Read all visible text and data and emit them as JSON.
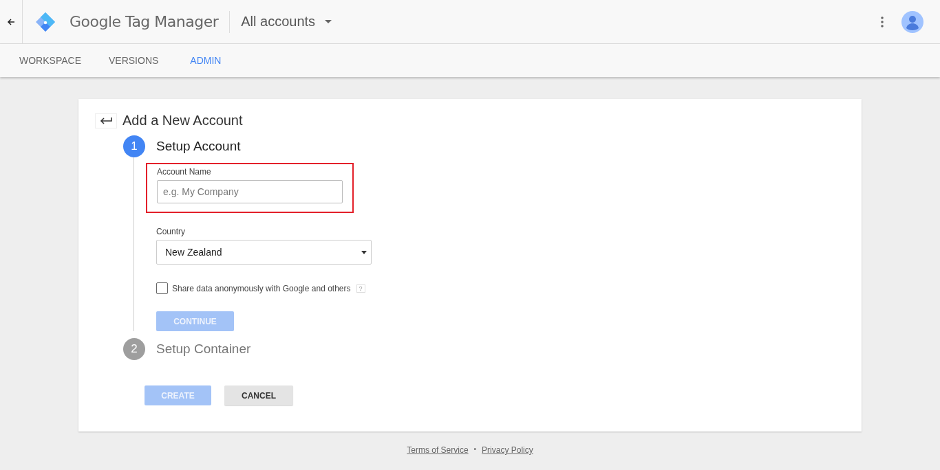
{
  "header": {
    "brand": "Google",
    "product_suffix": "Tag Manager",
    "account_switcher": "All accounts"
  },
  "tabs": [
    {
      "label": "WORKSPACE",
      "selected": false
    },
    {
      "label": "VERSIONS",
      "selected": false
    },
    {
      "label": "ADMIN",
      "selected": true
    }
  ],
  "card": {
    "title": "Add a New Account",
    "steps": [
      {
        "number": "1",
        "title": "Setup Account",
        "active": true
      },
      {
        "number": "2",
        "title": "Setup Container",
        "active": false
      }
    ],
    "account_name": {
      "label": "Account Name",
      "placeholder": "e.g. My Company",
      "highlighted": true
    },
    "country": {
      "label": "Country",
      "value": "New Zealand"
    },
    "share_data": {
      "label": "Share data anonymously with Google and others",
      "checked": false,
      "help": "?"
    },
    "continue_button": {
      "label": "CONTINUE",
      "disabled": true
    },
    "buttons": [
      {
        "label": "CREATE",
        "kind": "primary",
        "disabled": true
      },
      {
        "label": "CANCEL",
        "kind": "secondary",
        "disabled": false
      }
    ]
  },
  "footer": {
    "links": [
      "Terms of Service",
      "Privacy Policy"
    ],
    "separator": "•"
  }
}
